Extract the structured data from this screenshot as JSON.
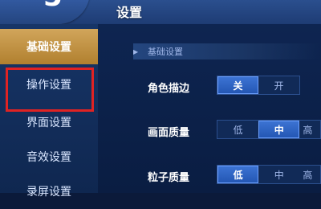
{
  "header": {
    "title": "设置",
    "back_glyph": "5"
  },
  "sidebar": {
    "items": [
      {
        "label": "基础设置"
      },
      {
        "label": "操作设置"
      },
      {
        "label": "界面设置"
      },
      {
        "label": "音效设置"
      },
      {
        "label": "录屏设置"
      }
    ]
  },
  "section": {
    "title": "基础设置"
  },
  "settings": [
    {
      "label": "角色描边",
      "options": [
        "关",
        "开"
      ]
    },
    {
      "label": "画面质量",
      "options": [
        "低",
        "中",
        "高"
      ]
    },
    {
      "label": "粒子质量",
      "options": [
        "低",
        "中",
        "高"
      ]
    }
  ]
}
